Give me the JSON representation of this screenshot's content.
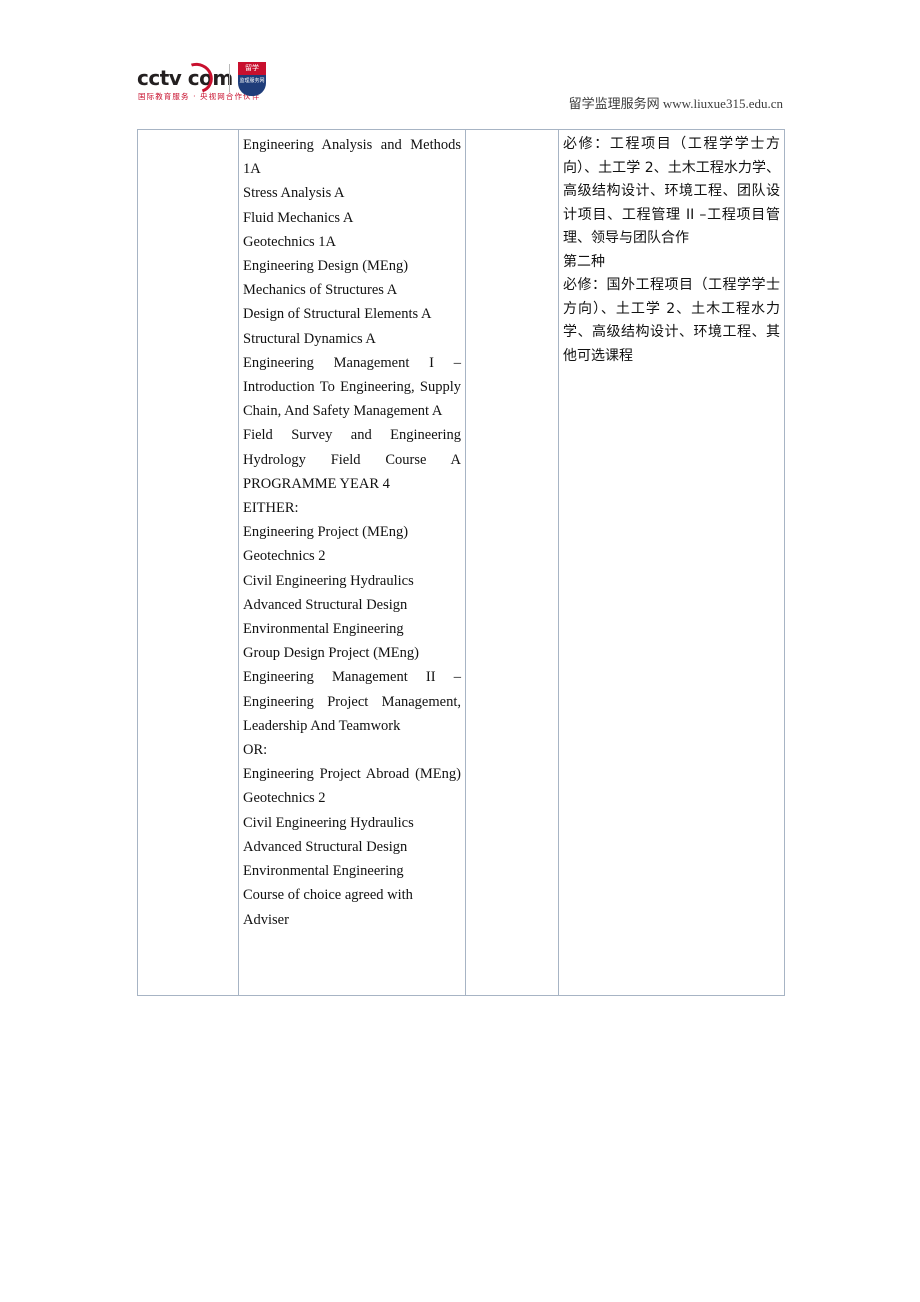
{
  "header": {
    "logo": {
      "wordmark": "cctv com",
      "tagline": "国际教育服务 · 央视网合作伙伴",
      "shield_top": "留学",
      "shield_body": "监理服务网"
    },
    "site_cn": "留学监理服务网",
    "site_url": "www.liuxue315.edu.cn"
  },
  "table": {
    "columns": [
      "",
      "courses_en",
      "",
      "courses_cn"
    ],
    "row": {
      "col_a": "",
      "col_c": "",
      "courses_en": [
        "Engineering Analysis and Methods 1A",
        "Stress Analysis A",
        "Fluid Mechanics A",
        "Geotechnics 1A",
        "Engineering Design (MEng)",
        "Mechanics of Structures A",
        "Design of Structural Elements A",
        "Structural Dynamics A",
        "Engineering Management I – Introduction To Engineering, Supply Chain, And Safety Management A",
        "Field Survey and Engineering Hydrology Field Course A",
        "PROGRAMME YEAR 4",
        "EITHER:",
        "Engineering Project (MEng)",
        "Geotechnics 2",
        "Civil Engineering Hydraulics",
        "Advanced Structural Design",
        "Environmental Engineering",
        "Group Design Project (MEng)",
        "Engineering Management II – Engineering Project Management, Leadership And Teamwork",
        "OR:",
        "Engineering Project Abroad (MEng)",
        "Geotechnics 2",
        "Civil Engineering Hydraulics",
        "Advanced Structural Design",
        "Environmental Engineering",
        "Course of choice agreed with Adviser"
      ],
      "courses_cn": [
        "必修：工程项目（工程学学士方向）、土工学 2、土木工程水力学、高级结构设计、环境工程、团队设计项目、工程管理 II –工程项目管理、领导与团队合作",
        "第二种",
        "必修：国外工程项目（工程学学士方向）、土工学 2、土木工程水力学、高级结构设计、环境工程、其他可选课程"
      ]
    }
  },
  "colors": {
    "border": "#a7b4c4",
    "brand_red": "#c8102e",
    "brand_navy": "#1f3d7a",
    "text": "#111111"
  }
}
